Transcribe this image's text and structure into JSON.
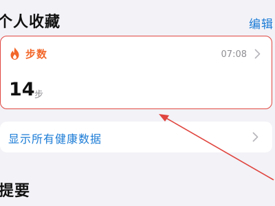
{
  "favorites": {
    "title": "个人收藏",
    "edit_label": "编辑"
  },
  "steps_card": {
    "icon": "flame-icon",
    "metric_name": "步数",
    "time": "07:08",
    "value": "14",
    "unit": "步",
    "accent_color": "#f2672a",
    "highlight_color": "#e0453f"
  },
  "show_all": {
    "label": "显示所有健康数据"
  },
  "summary": {
    "title": "提要"
  }
}
